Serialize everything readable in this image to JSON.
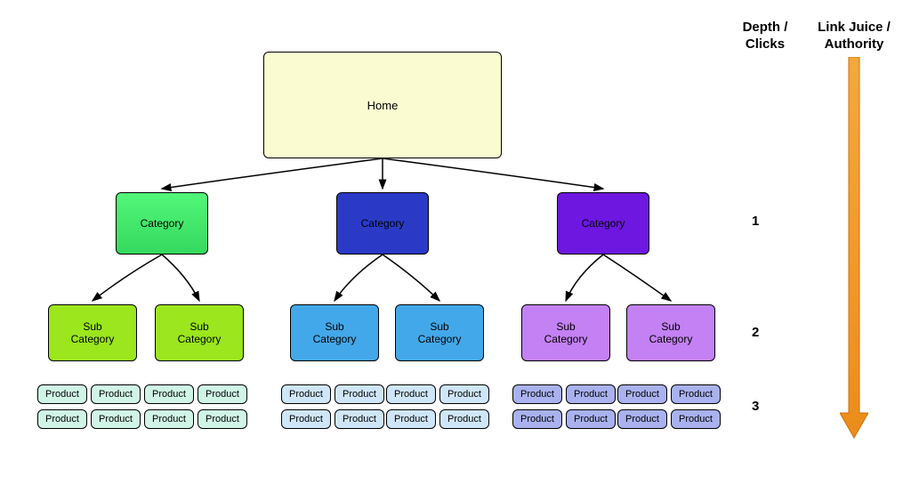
{
  "header": {
    "depthClicks": "Depth /\nClicks",
    "linkJuice": "Link Juice /\nAuthority"
  },
  "depthLabels": {
    "d1": "1",
    "d2": "2",
    "d3": "3"
  },
  "home": {
    "label": "Home"
  },
  "categories": [
    {
      "label": "Category",
      "color": "green"
    },
    {
      "label": "Category",
      "color": "blue"
    },
    {
      "label": "Category",
      "color": "purple"
    }
  ],
  "subcategories": [
    {
      "label": "Sub\nCategory",
      "color": "green"
    },
    {
      "label": "Sub\nCategory",
      "color": "green"
    },
    {
      "label": "Sub\nCategory",
      "color": "blue"
    },
    {
      "label": "Sub\nCategory",
      "color": "blue"
    },
    {
      "label": "Sub\nCategory",
      "color": "purple"
    },
    {
      "label": "Sub\nCategory",
      "color": "purple"
    }
  ],
  "products": {
    "label": "Product",
    "columnsPerSub": 2,
    "rows": 2
  },
  "arrowColor": "#ec8c1a"
}
